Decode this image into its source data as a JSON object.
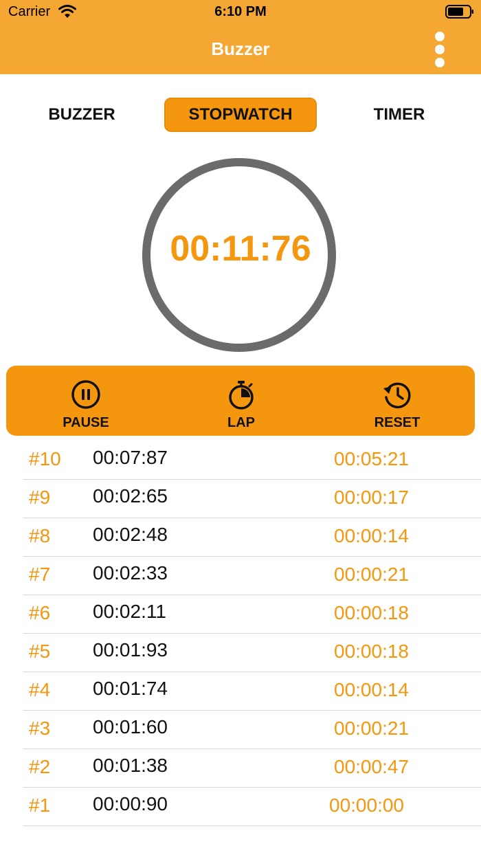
{
  "status_bar": {
    "carrier": "Carrier",
    "time": "6:10 PM"
  },
  "nav": {
    "title": "Buzzer",
    "more_icon": "more-vertical-icon"
  },
  "tabs": [
    {
      "label": "BUZZER",
      "active": false
    },
    {
      "label": "STOPWATCH",
      "active": true
    },
    {
      "label": "TIMER",
      "active": false
    }
  ],
  "stopwatch": {
    "elapsed": "00:11:76"
  },
  "controls": {
    "pause_label": "PAUSE",
    "pause_icon": "pause-circle-icon",
    "lap_label": "LAP",
    "lap_icon": "stopwatch-icon",
    "reset_label": "RESET",
    "reset_icon": "history-icon"
  },
  "laps": [
    {
      "number": "#10",
      "total": "00:07:87",
      "split": "00:05:21"
    },
    {
      "number": "#9",
      "total": "00:02:65",
      "split": "00:00:17"
    },
    {
      "number": "#8",
      "total": "00:02:48",
      "split": "00:00:14"
    },
    {
      "number": "#7",
      "total": "00:02:33",
      "split": "00:00:21"
    },
    {
      "number": "#6",
      "total": "00:02:11",
      "split": "00:00:18"
    },
    {
      "number": "#5",
      "total": "00:01:93",
      "split": "00:00:18"
    },
    {
      "number": "#4",
      "total": "00:01:74",
      "split": "00:00:14"
    },
    {
      "number": "#3",
      "total": "00:01:60",
      "split": "00:00:21"
    },
    {
      "number": "#2",
      "total": "00:01:38",
      "split": "00:00:47"
    },
    {
      "number": "#1",
      "total": "00:00:90",
      "split": "00:00:00"
    }
  ],
  "colors": {
    "header": "#f5a733",
    "accent": "#f5960f",
    "dial_ring": "#6b6b6b"
  }
}
